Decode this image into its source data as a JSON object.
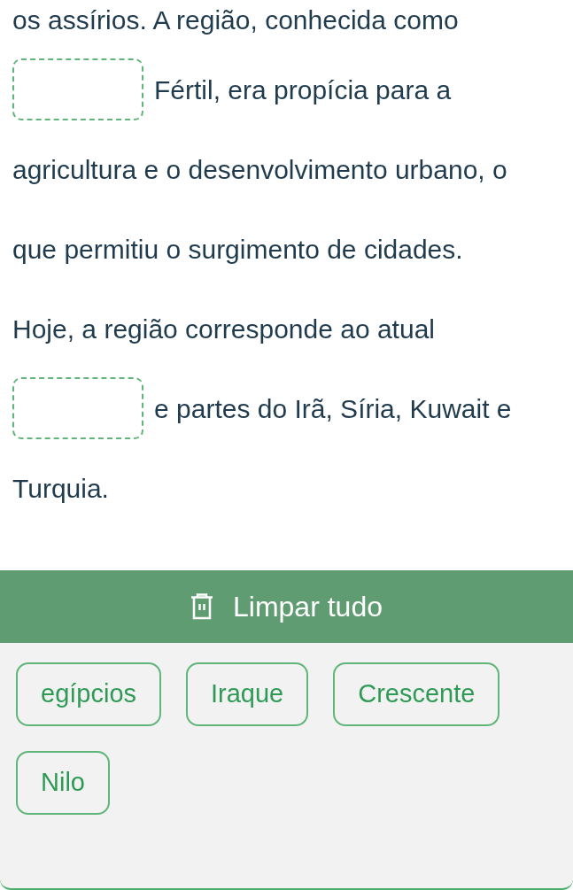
{
  "passage": [
    {
      "parts": [
        {
          "kind": "text",
          "text": "os assírios. A região, conhecida como"
        }
      ]
    },
    {
      "parts": [
        {
          "kind": "blank"
        },
        {
          "kind": "text",
          "text": "Fértil, era propícia para a"
        }
      ]
    },
    {
      "parts": [
        {
          "kind": "text",
          "text": "agricultura e o desenvolvimento urbano, o"
        }
      ]
    },
    {
      "parts": [
        {
          "kind": "text",
          "text": "que permitiu o surgimento de cidades."
        }
      ]
    },
    {
      "parts": [
        {
          "kind": "text",
          "text": "Hoje, a região corresponde ao atual"
        }
      ]
    },
    {
      "parts": [
        {
          "kind": "blank"
        },
        {
          "kind": "text",
          "text": "e partes do Irã, Síria, Kuwait e"
        }
      ]
    },
    {
      "parts": [
        {
          "kind": "text",
          "text": "Turquia."
        }
      ]
    }
  ],
  "clear_button": {
    "label": "Limpar tudo"
  },
  "options": [
    "egípcios",
    "Iraque",
    "Crescente",
    "Nilo"
  ]
}
